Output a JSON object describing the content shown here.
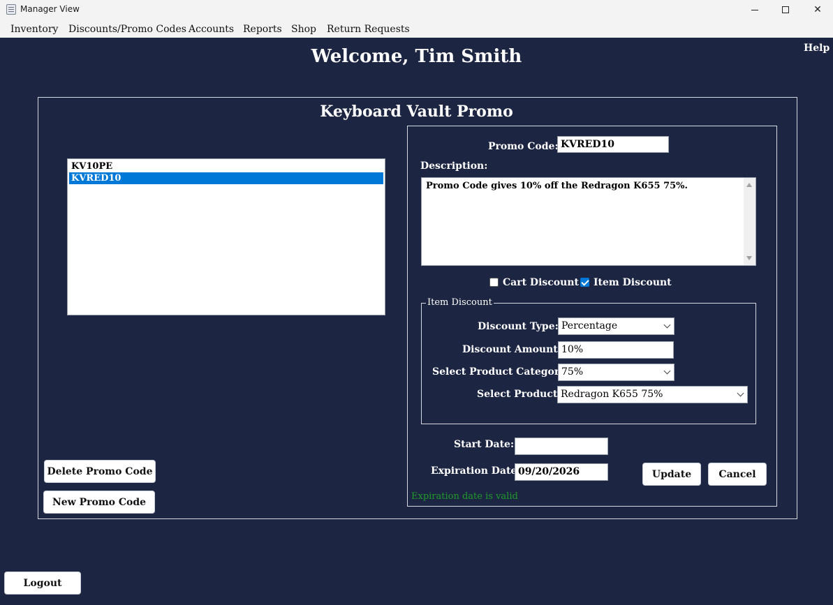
{
  "window": {
    "title": "Manager View"
  },
  "menu": {
    "items": [
      "Inventory",
      "Discounts/Promo Codes",
      "Accounts",
      "Reports",
      "Shop",
      "Return Requests"
    ]
  },
  "header": {
    "help": "Help",
    "welcome": "Welcome, Tim Smith"
  },
  "panel": {
    "title": "Keyboard Vault Promo"
  },
  "promo_list": {
    "items": [
      "KV10PE",
      "KVRED10"
    ],
    "selected": "KVRED10"
  },
  "buttons": {
    "delete": "Delete Promo Code",
    "new": "New Promo Code",
    "logout": "Logout",
    "update": "Update",
    "cancel": "Cancel"
  },
  "form": {
    "promo_code_label": "Promo Code:",
    "promo_code_value": "KVRED10",
    "description_label": "Description:",
    "description_value": "Promo Code gives 10% off the Redragon K655 75%.",
    "cart_discount_label": "Cart Discount",
    "cart_discount_checked": false,
    "item_discount_label": "Item Discount",
    "item_discount_checked": true,
    "group_title": "Item Discount",
    "discount_type_label": "Discount Type:",
    "discount_type_value": "Percentage",
    "discount_amount_label": "Discount Amount:",
    "discount_amount_value": "10%",
    "category_label": "Select Product Category:",
    "category_value": "75%",
    "product_label": "Select Product:",
    "product_value": "Redragon K655 75%",
    "start_date_label": "Start Date:",
    "start_date_value": "",
    "expiration_date_label": "Expiration Date:",
    "expiration_date_value": "09/20/2026",
    "validation_message": "Expiration date is valid"
  },
  "colors": {
    "background": "#1c2541",
    "selection": "#0078d7",
    "valid_text": "#1f9d2a"
  }
}
